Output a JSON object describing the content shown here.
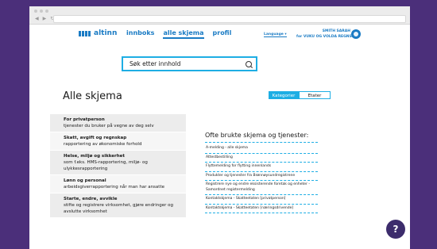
{
  "header": {
    "logo_text": "altinn",
    "nav": [
      "innboks",
      "alle skjema",
      "profil"
    ],
    "language": "Language ▾",
    "user_name": "SMITH SARAH",
    "user_org": "for VUKU OG VOLDA REGNSKAP"
  },
  "search": {
    "placeholder": "Søk etter innhold",
    "icon": "search-icon"
  },
  "main": {
    "title": "Alle skjema",
    "toggle": {
      "active": "Kategorier",
      "inactive": "Etater"
    }
  },
  "categories": [
    {
      "title": "For privatperson",
      "desc": "tjenester du bruker på vegne av deg selv"
    },
    {
      "title": "Skatt, avgift og regnskap",
      "desc": "rapportering av økonomiske forhold"
    },
    {
      "title": "Helse, miljø og sikkerhet",
      "desc": "som f.eks. HMS-rapportering, miljø- og ulykkesrapportering"
    },
    {
      "title": "Lønn og personal",
      "desc": "arbeidsgiverrapportering når man har ansatte"
    },
    {
      "title": "Starte, endre, avvikle",
      "desc": "stifte og registrere virksomhet, gjøre endringer og avslutte virksomhet"
    }
  ],
  "popular": {
    "heading": "Ofte brukte skjema og tjenester:",
    "items": [
      "A-melding - alle skjema",
      "Attestbestilling",
      "Flyttemelding for flytting innenlands",
      "Produkter og tjenester fra Brønnøysundregistrene",
      "Registrere nye og endre eksisterende foretak og enheter - Samordnet registermelding",
      "Kontaktskjema - Skatteetaten [privatperson]",
      "Kontaktskjema - Skatteetaten [næringsdrivende]"
    ]
  },
  "help": {
    "label": "?"
  },
  "colors": {
    "brand": "#1a7bc4",
    "accent": "#1eaee4",
    "background": "#4b2f7a",
    "help": "#3c2c6c"
  }
}
